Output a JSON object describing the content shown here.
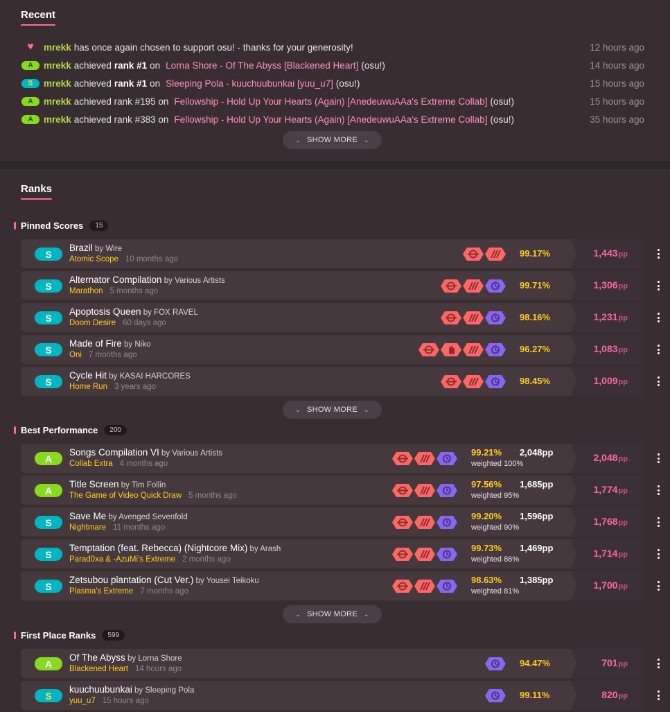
{
  "colors": {
    "accent": "#ff66ab",
    "yellow": "#ffcc22",
    "green": "#88da20",
    "teal": "#02b5c3",
    "mod_red": "#ff6666",
    "mod_purple": "#8866ee"
  },
  "recent": {
    "title": "Recent",
    "items": [
      {
        "icon": "heart-icon",
        "user": "mrekk",
        "parts": [
          {
            "t": "has once again chosen to support osu! - thanks for your generosity!",
            "s": "text"
          }
        ],
        "time": "12 hours ago"
      },
      {
        "icon": "rank-A",
        "user": "mrekk",
        "parts": [
          {
            "t": "achieved",
            "s": "text"
          },
          {
            "t": "rank #1",
            "s": "bold"
          },
          {
            "t": "on",
            "s": "text"
          },
          {
            "t": "Lorna Shore - Of The Abyss [Blackened Heart]",
            "s": "link"
          },
          {
            "t": "(osu!)",
            "s": "text"
          }
        ],
        "time": "14 hours ago"
      },
      {
        "icon": "rank-S",
        "user": "mrekk",
        "parts": [
          {
            "t": "achieved",
            "s": "text"
          },
          {
            "t": "rank #1",
            "s": "bold"
          },
          {
            "t": "on",
            "s": "text"
          },
          {
            "t": "Sleeping Pola - kuuchuubunkai [yuu_u7]",
            "s": "link"
          },
          {
            "t": "(osu!)",
            "s": "text"
          }
        ],
        "time": "15 hours ago"
      },
      {
        "icon": "rank-A",
        "user": "mrekk",
        "parts": [
          {
            "t": "achieved rank #195 on",
            "s": "text"
          },
          {
            "t": "Fellowship - Hold Up Your Hearts (Again) [AnedeuwuAAa's Extreme Collab]",
            "s": "link"
          },
          {
            "t": "(osu!)",
            "s": "text"
          }
        ],
        "time": "15 hours ago"
      },
      {
        "icon": "rank-A",
        "user": "mrekk",
        "parts": [
          {
            "t": "achieved rank #383 on",
            "s": "text"
          },
          {
            "t": "Fellowship - Hold Up Your Hearts (Again) [AnedeuwuAAa's Extreme Collab]",
            "s": "link"
          },
          {
            "t": "(osu!)",
            "s": "text"
          }
        ],
        "time": "35 hours ago"
      }
    ],
    "show_more": "SHOW MORE"
  },
  "ranks": {
    "title": "Ranks",
    "pinned": {
      "label": "Pinned Scores",
      "count": "15",
      "show_more": "SHOW MORE",
      "scores": [
        {
          "grade": "S",
          "title": "Brazil",
          "artist": "Wire",
          "diff": "Atomic Scope",
          "ago": "10 months ago",
          "mods": [
            "HR",
            "DT"
          ],
          "acc": "99.17%",
          "pp": "1,443"
        },
        {
          "grade": "S",
          "title": "Alternator Compilation",
          "artist": "Various Artists",
          "diff": "Marathon",
          "ago": "5 months ago",
          "mods": [
            "HR",
            "DT",
            "SD"
          ],
          "acc": "99.71%",
          "pp": "1,306"
        },
        {
          "grade": "S",
          "title": "Apoptosis Queen",
          "artist": "FOX RAVEL",
          "diff": "Doom Desire",
          "ago": "60 days ago",
          "mods": [
            "HR",
            "DT",
            "SD"
          ],
          "acc": "98.16%",
          "pp": "1,231"
        },
        {
          "grade": "S",
          "title": "Made of Fire",
          "artist": "Niko",
          "diff": "Oni",
          "ago": "7 months ago",
          "mods": [
            "HR",
            "TC",
            "DT",
            "SD"
          ],
          "acc": "96.27%",
          "pp": "1,083"
        },
        {
          "grade": "S",
          "title": "Cycle Hit",
          "artist": "KASAI HARCORES",
          "diff": "Home Run",
          "ago": "3 years ago",
          "mods": [
            "HR",
            "DT",
            "SD"
          ],
          "acc": "98.45%",
          "pp": "1,009"
        }
      ]
    },
    "best": {
      "label": "Best Performance",
      "count": "200",
      "show_more": "SHOW MORE",
      "scores": [
        {
          "grade": "A",
          "title": "Songs Compilation VI",
          "artist": "Various Artists",
          "diff": "Collab Extra",
          "ago": "4 months ago",
          "mods": [
            "HR",
            "DT",
            "SD"
          ],
          "acc": "99.21%",
          "weighted": "weighted 100%",
          "raw_pp": "2,048pp",
          "pp": "2,048"
        },
        {
          "grade": "A",
          "title": "Title Screen",
          "artist": "Tim Follin",
          "diff": "The Game of Video Quick Draw",
          "ago": "5 months ago",
          "mods": [
            "HR",
            "DT",
            "SD"
          ],
          "acc": "97.56%",
          "weighted": "weighted 95%",
          "raw_pp": "1,685pp",
          "pp": "1,774"
        },
        {
          "grade": "S",
          "title": "Save Me",
          "artist": "Avenged Sevenfold",
          "diff": "Nightmare",
          "ago": "11 months ago",
          "mods": [
            "HR",
            "DT",
            "SD"
          ],
          "acc": "99.20%",
          "weighted": "weighted 90%",
          "raw_pp": "1,596pp",
          "pp": "1,768"
        },
        {
          "grade": "S",
          "title": "Temptation (feat. Rebecca) (Nightcore Mix)",
          "artist": "Arash",
          "diff": "Parad0xa & -AzuMi's Extreme",
          "ago": "2 months ago",
          "mods": [
            "HR",
            "DT",
            "SD"
          ],
          "acc": "99.73%",
          "weighted": "weighted 86%",
          "raw_pp": "1,469pp",
          "pp": "1,714"
        },
        {
          "grade": "S",
          "title": "Zetsubou plantation (Cut Ver.)",
          "artist": "Yousei Teikoku",
          "diff": "Plasma's Extreme",
          "ago": "7 months ago",
          "mods": [
            "HR",
            "DT",
            "SD"
          ],
          "acc": "98.63%",
          "weighted": "weighted 81%",
          "raw_pp": "1,385pp",
          "pp": "1,700"
        }
      ]
    },
    "first": {
      "label": "First Place Ranks",
      "count": "599",
      "scores": [
        {
          "grade": "A",
          "title": "Of The Abyss",
          "artist": "Lorna Shore",
          "diff": "Blackened Heart",
          "ago": "14 hours ago",
          "mods": [
            "SD"
          ],
          "acc": "94.47%",
          "pp": "701"
        },
        {
          "grade": "Sgold",
          "title": "kuuchuubunkai",
          "artist": "Sleeping Pola",
          "diff": "yuu_u7",
          "ago": "15 hours ago",
          "mods": [
            "SD"
          ],
          "acc": "99.11%",
          "pp": "820"
        }
      ]
    },
    "by_word": "by",
    "pp_unit": "pp"
  }
}
